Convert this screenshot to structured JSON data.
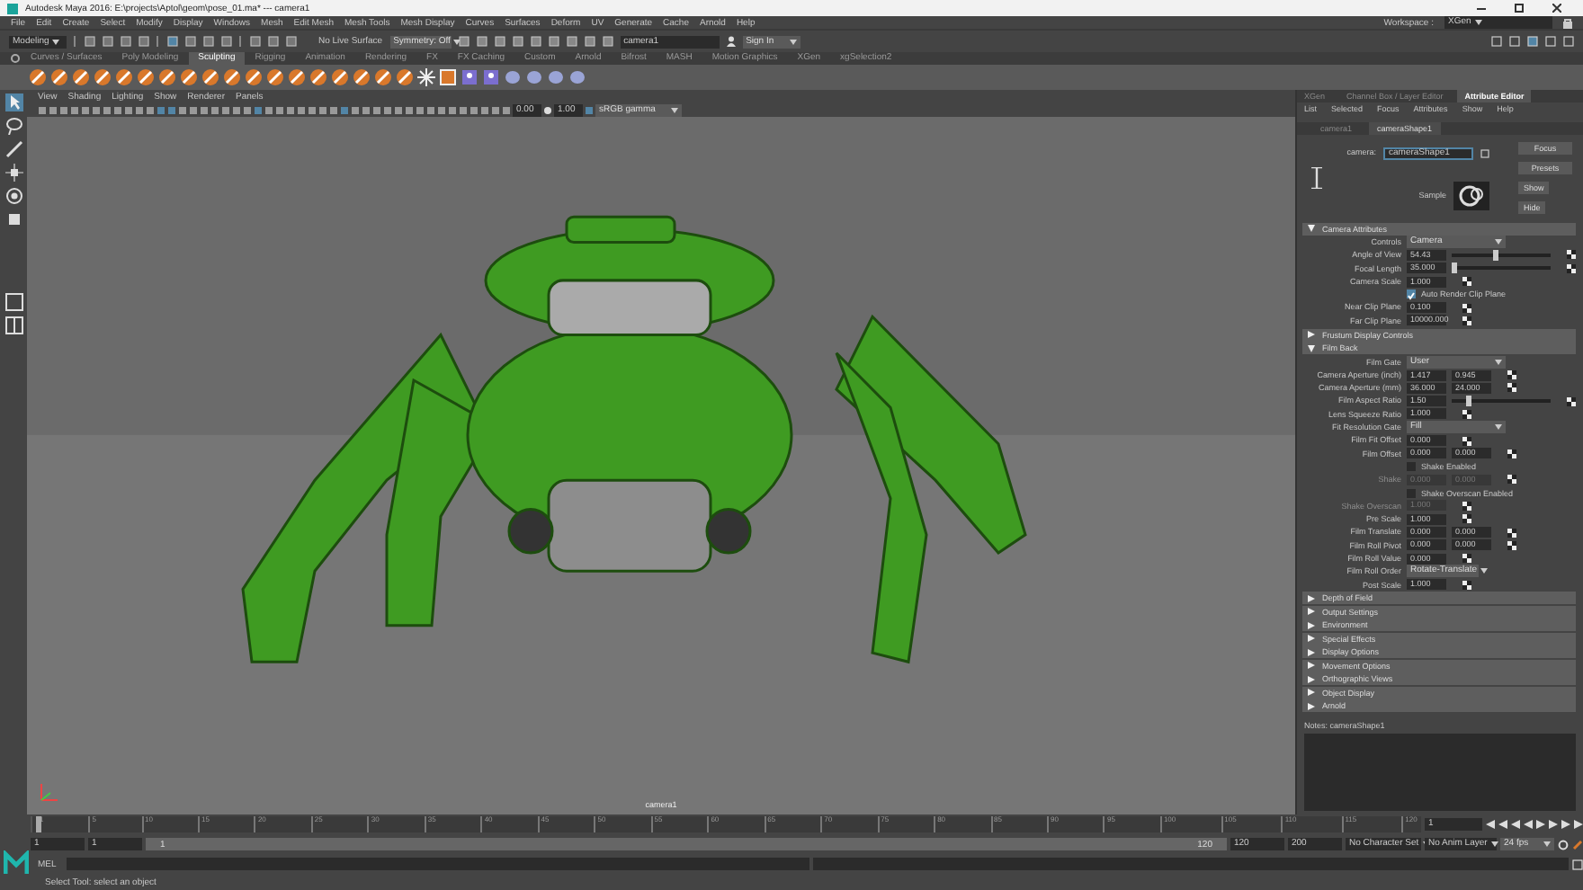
{
  "window": {
    "title": "Autodesk Maya 2016: E:\\projects\\Aptol\\geom\\pose_01.ma*  ---  camera1"
  },
  "menu_bar": {
    "items": [
      "File",
      "Edit",
      "Create",
      "Select",
      "Modify",
      "Display",
      "Windows",
      "Mesh",
      "Edit Mesh",
      "Mesh Tools",
      "Mesh Display",
      "Curves",
      "Surfaces",
      "Deform",
      "UV",
      "Generate",
      "Cache",
      "Arnold",
      "Help"
    ],
    "workspace_label": "Workspace :",
    "workspace": "XGen"
  },
  "status_line": {
    "mode": "Modeling",
    "live_surface": "No Live Surface",
    "symmetry": "Symmetry: Off",
    "camera_field": "camera1",
    "sign_in": "Sign In"
  },
  "shelf": {
    "tabs": [
      {
        "label": "Curves / Surfaces",
        "selected": false
      },
      {
        "label": "Poly Modeling",
        "selected": false
      },
      {
        "label": "Sculpting",
        "selected": true
      },
      {
        "label": "Rigging",
        "selected": false
      },
      {
        "label": "Animation",
        "selected": false
      },
      {
        "label": "Rendering",
        "selected": false
      },
      {
        "label": "FX",
        "selected": false
      },
      {
        "label": "FX Caching",
        "selected": false
      },
      {
        "label": "Custom",
        "selected": false
      },
      {
        "label": "Arnold",
        "selected": false
      },
      {
        "label": "Bifrost",
        "selected": false
      },
      {
        "label": "MASH",
        "selected": false
      },
      {
        "label": "Motion Graphics",
        "selected": false
      },
      {
        "label": "XGen",
        "selected": false
      },
      {
        "label": "xgSelection2",
        "selected": false
      }
    ]
  },
  "panel_menu": [
    "View",
    "Shading",
    "Lighting",
    "Show",
    "Renderer",
    "Panels"
  ],
  "panel_toolbar": {
    "exposure": "0.00",
    "gamma": "1.00",
    "color_space": "sRGB gamma"
  },
  "viewport": {
    "camera_label": "camera1"
  },
  "attribute_editor": {
    "panel_tabs": [
      {
        "label": "XGen",
        "selected": false
      },
      {
        "label": "Channel Box / Layer Editor",
        "selected": false
      },
      {
        "label": "Attribute Editor",
        "selected": true
      }
    ],
    "menu": [
      "List",
      "Selected",
      "Focus",
      "Attributes",
      "Show",
      "Help"
    ],
    "node_tabs": [
      {
        "label": "camera1",
        "selected": false
      },
      {
        "label": "cameraShape1",
        "selected": true
      }
    ],
    "node_label": "camera:",
    "node_name": "cameraShape1",
    "buttons": [
      "Focus",
      "Presets",
      "Show",
      "Hide"
    ],
    "sample_label": "Sample",
    "sections": [
      {
        "title": "Camera Attributes",
        "expanded": true,
        "rows": [
          {
            "kind": "dropdown",
            "label": "Controls",
            "values": [
              "Camera"
            ],
            "disabled": false
          },
          {
            "kind": "slider",
            "label": "Angle of View",
            "values": [
              "54.43"
            ],
            "level": 0.45,
            "disabled": false
          },
          {
            "kind": "slider",
            "label": "Focal Length",
            "values": [
              "35.000"
            ],
            "level": 0.02,
            "disabled": false
          },
          {
            "kind": "number",
            "label": "Camera Scale",
            "values": [
              "1.000"
            ],
            "disabled": false
          },
          {
            "kind": "checkbox",
            "label": "Auto Render Clip Plane",
            "checked": true,
            "disabled": false
          },
          {
            "kind": "number",
            "label": "Near Clip Plane",
            "values": [
              "0.100"
            ],
            "disabled": false
          },
          {
            "kind": "number",
            "label": "Far Clip Plane",
            "values": [
              "10000.000"
            ],
            "disabled": false
          }
        ]
      },
      {
        "title": "Frustum Display Controls",
        "expanded": false
      },
      {
        "title": "Film Back",
        "expanded": true,
        "rows": [
          {
            "kind": "dropdown",
            "label": "Film Gate",
            "values": [
              "User"
            ],
            "disabled": false
          },
          {
            "kind": "number",
            "label": "Camera Aperture (inch)",
            "values": [
              "1.417",
              "0.945"
            ],
            "disabled": false
          },
          {
            "kind": "number",
            "label": "Camera Aperture (mm)",
            "values": [
              "36.000",
              "24.000"
            ],
            "disabled": false
          },
          {
            "kind": "slider",
            "label": "Film Aspect Ratio",
            "values": [
              "1.50"
            ],
            "level": 0.17,
            "disabled": false
          },
          {
            "kind": "number",
            "label": "Lens Squeeze Ratio",
            "values": [
              "1.000"
            ],
            "disabled": false
          },
          {
            "kind": "dropdown",
            "label": "Fit Resolution Gate",
            "values": [
              "Fill"
            ],
            "disabled": false
          },
          {
            "kind": "number",
            "label": "Film Fit Offset",
            "values": [
              "0.000"
            ],
            "disabled": false
          },
          {
            "kind": "number",
            "label": "Film Offset",
            "values": [
              "0.000",
              "0.000"
            ],
            "disabled": false
          },
          {
            "kind": "checkbox",
            "label": "Shake Enabled",
            "checked": false,
            "disabled": false
          },
          {
            "kind": "number",
            "label": "Shake",
            "values": [
              "0.000",
              "0.000"
            ],
            "disabled": true
          },
          {
            "kind": "checkbox",
            "label": "Shake Overscan Enabled",
            "checked": false,
            "disabled": false
          },
          {
            "kind": "number",
            "label": "Shake Overscan",
            "values": [
              "1.000"
            ],
            "disabled": true
          },
          {
            "kind": "number",
            "label": "Pre Scale",
            "values": [
              "1.000"
            ],
            "disabled": false
          },
          {
            "kind": "number",
            "label": "Film Translate",
            "values": [
              "0.000",
              "0.000"
            ],
            "disabled": false
          },
          {
            "kind": "number",
            "label": "Film Roll Pivot",
            "values": [
              "0.000",
              "0.000"
            ],
            "disabled": false
          },
          {
            "kind": "number",
            "label": "Film Roll Value",
            "values": [
              "0.000"
            ],
            "disabled": false
          },
          {
            "kind": "dropdown",
            "label": "Film Roll Order",
            "values": [
              "Rotate-Translate"
            ],
            "disabled": false
          },
          {
            "kind": "number",
            "label": "Post Scale",
            "values": [
              "1.000"
            ],
            "disabled": false
          }
        ]
      },
      {
        "title": "Depth of Field",
        "expanded": false
      },
      {
        "title": "Output Settings",
        "expanded": false
      },
      {
        "title": "Environment",
        "expanded": false
      },
      {
        "title": "Special Effects",
        "expanded": false
      },
      {
        "title": "Display Options",
        "expanded": false
      },
      {
        "title": "Movement Options",
        "expanded": false
      },
      {
        "title": "Orthographic Views",
        "expanded": false
      },
      {
        "title": "Object Display",
        "expanded": false
      },
      {
        "title": "Arnold",
        "expanded": false
      }
    ],
    "notes_label": "Notes:  cameraShape1"
  },
  "time_slider": {
    "ticks": [
      "1",
      "5",
      "10",
      "15",
      "20",
      "25",
      "30",
      "35",
      "40",
      "45",
      "50",
      "55",
      "60",
      "65",
      "70",
      "75",
      "80",
      "85",
      "90",
      "95",
      "100",
      "105",
      "110",
      "115",
      "120"
    ],
    "current_frame": "1",
    "level": 0
  },
  "range_slider": {
    "level": 1,
    "start": "1",
    "playback_start": "1",
    "range_start": "1",
    "range_end": "120",
    "playback_end": "120",
    "end": "200",
    "character_set": "No Character Set",
    "anim_layer": "No Anim Layer",
    "fps": "24 fps"
  },
  "command_line": {
    "label": "MEL"
  },
  "help_line": "Select Tool: select an object"
}
